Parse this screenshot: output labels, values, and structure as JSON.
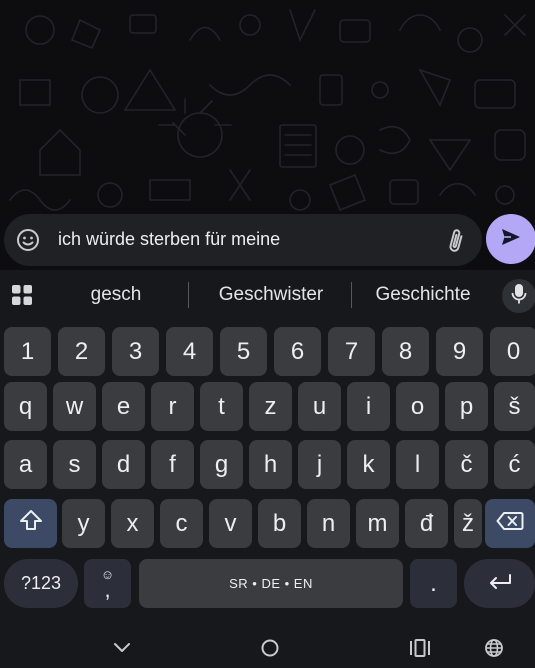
{
  "composer": {
    "text": "ich würde sterben für meine"
  },
  "suggestions": [
    "gesch",
    "Geschwister",
    "Geschichte"
  ],
  "keyboard": {
    "row_numbers": [
      "1",
      "2",
      "3",
      "4",
      "5",
      "6",
      "7",
      "8",
      "9",
      "0"
    ],
    "row_1": [
      "q",
      "w",
      "e",
      "r",
      "t",
      "z",
      "u",
      "i",
      "o",
      "p",
      "š"
    ],
    "row_2": [
      "a",
      "s",
      "d",
      "f",
      "g",
      "h",
      "j",
      "k",
      "l",
      "č",
      "ć"
    ],
    "row_3": [
      "y",
      "x",
      "c",
      "v",
      "b",
      "n",
      "m",
      "đ",
      "ž"
    ],
    "symbols_label": "?123",
    "comma_label": ",",
    "space_label": "SR • DE • EN",
    "period_label": "."
  },
  "icons": {
    "emoji": "emoji-icon",
    "attach": "paperclip-icon",
    "send": "send-icon",
    "grid": "grid-icon",
    "mic": "microphone-icon",
    "shift": "shift-icon",
    "backspace": "backspace-icon",
    "enter": "enter-icon",
    "hide_keyboard": "chevron-down-icon",
    "home": "circle-icon",
    "recents": "recents-icon",
    "language": "globe-icon"
  },
  "colors": {
    "send_button": "#b4a7f5",
    "key": "#3a3c40",
    "shift_key": "#3c4a66",
    "keyboard_bg": "#16181b"
  }
}
